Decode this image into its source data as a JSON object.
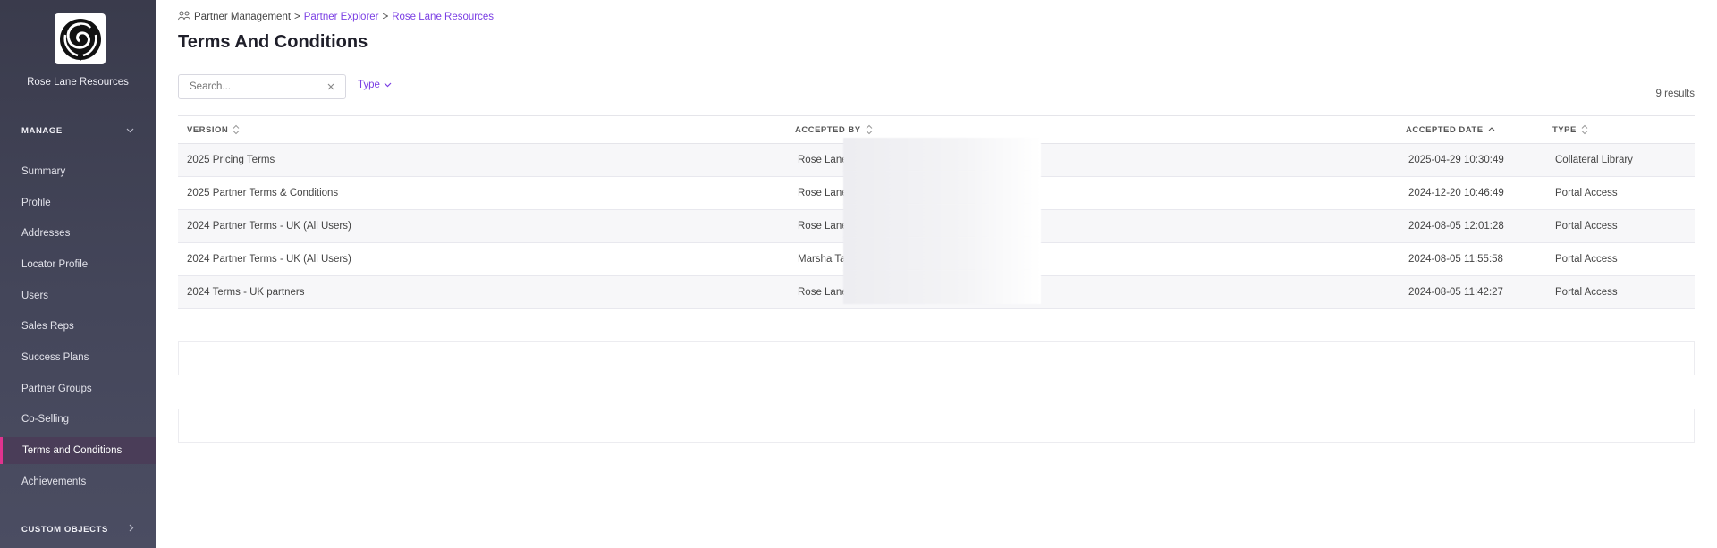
{
  "sidebar": {
    "company_name": "Rose Lane Resources",
    "manage_label": "MANAGE",
    "custom_objects_label": "CUSTOM OBJECTS",
    "items": [
      {
        "label": "Summary"
      },
      {
        "label": "Profile"
      },
      {
        "label": "Addresses"
      },
      {
        "label": "Locator Profile"
      },
      {
        "label": "Users"
      },
      {
        "label": "Sales Reps"
      },
      {
        "label": "Success Plans"
      },
      {
        "label": "Partner Groups"
      },
      {
        "label": "Co-Selling"
      },
      {
        "label": "Terms and Conditions",
        "active": true
      },
      {
        "label": "Achievements"
      }
    ],
    "accent_color": "#e0338e"
  },
  "breadcrumb": {
    "root": "Partner Management",
    "sep": ">",
    "explorer": "Partner Explorer",
    "partner": "Rose Lane Resources"
  },
  "page": {
    "title": "Terms And Conditions"
  },
  "filters": {
    "search_placeholder": "Search...",
    "type_label": "Type",
    "results_text": "9 results"
  },
  "table": {
    "headers": {
      "version": "VERSION",
      "accepted_by": "ACCEPTED BY",
      "accepted_date": "ACCEPTED DATE",
      "type": "TYPE"
    },
    "rows": [
      {
        "version": "2025 Pricing Terms",
        "accepted_by": "Rose Lane (",
        "accepted_date": "2025-04-29 10:30:49",
        "type": "Collateral Library"
      },
      {
        "version": "2025 Partner Terms & Conditions",
        "accepted_by": "Rose Lane (",
        "accepted_date": "2024-12-20 10:46:49",
        "type": "Portal Access"
      },
      {
        "version": "2024 Partner Terms - UK (All Users)",
        "accepted_by": "Rose Lane (",
        "accepted_date": "2024-08-05 12:01:28",
        "type": "Portal Access"
      },
      {
        "version": "2024 Partner Terms - UK (All Users)",
        "accepted_by": "Marsha Tayl",
        "accepted_date": "2024-08-05 11:55:58",
        "type": "Portal Access"
      },
      {
        "version": "2024 Terms - UK partners",
        "accepted_by": "Rose Lane (",
        "accepted_date": "2024-08-05 11:42:27",
        "type": "Portal Access"
      }
    ]
  },
  "colors": {
    "link": "#7b3fe4",
    "sidebar_bg": "#3a3b4c"
  }
}
